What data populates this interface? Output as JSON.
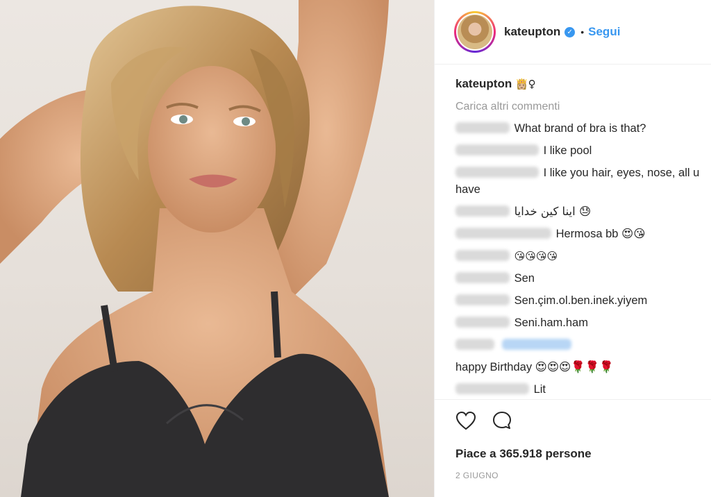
{
  "post": {
    "username": "kateupton",
    "follow_label": "Segui",
    "separator": "•",
    "caption_emoji": "👸🏼♀"
  },
  "comments": {
    "load_more": "Carica altri commenti",
    "items": [
      {
        "text": "What brand of bra is that?",
        "name_width": 78
      },
      {
        "text": "I like pool",
        "name_width": 120
      },
      {
        "text": "I like you hair, eyes, nose, all u have",
        "name_width": 120
      },
      {
        "text": "اینا کین خدایا 😓",
        "name_width": 78
      },
      {
        "text": "Hermosa bb 😍😘",
        "name_width": 138
      },
      {
        "text": "😘😘😘😘",
        "name_width": 78
      },
      {
        "text": "Sen",
        "name_width": 78
      },
      {
        "text": "Sen.çim.ol.ben.inek.yiyem",
        "name_width": 78
      },
      {
        "text": "Seni.ham.ham",
        "name_width": 78
      },
      {
        "text": "",
        "name_width": 56,
        "mention": true
      },
      {
        "text": "happy Birthday 😍😍😍🌹🌹🌹",
        "name_width": 0
      },
      {
        "text": "Lit",
        "name_width": 106
      }
    ]
  },
  "actions": {
    "like_icon": "heart-icon",
    "comment_icon": "comment-bubble-icon",
    "likes_text": "Piace a 365.918 persone",
    "date": "2 GIUGNO"
  },
  "colors": {
    "accent": "#3897f0",
    "text": "#262626",
    "muted": "#999999",
    "border": "#efefef"
  }
}
